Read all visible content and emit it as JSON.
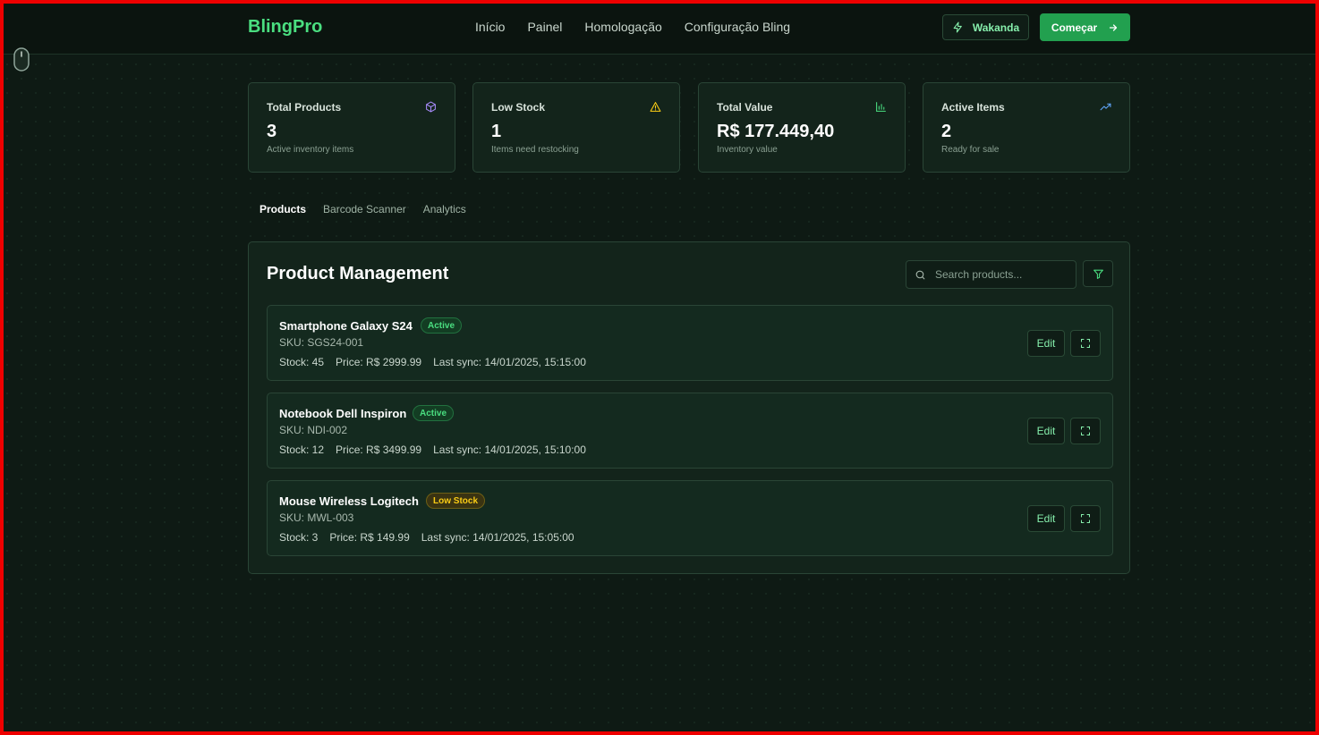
{
  "header": {
    "brand": "BlingPro",
    "nav": [
      "Início",
      "Painel",
      "Homologação",
      "Configuração Bling"
    ],
    "wakanda_label": "Wakanda",
    "start_label": "Começar"
  },
  "stats": [
    {
      "title": "Total Products",
      "value": "3",
      "subtitle": "Active inventory items",
      "icon": "package-icon",
      "icon_color": "#a78bfa"
    },
    {
      "title": "Low Stock",
      "value": "1",
      "subtitle": "Items need restocking",
      "icon": "warning-icon",
      "icon_color": "#facc15"
    },
    {
      "title": "Total Value",
      "value": "R$ 177.449,40",
      "subtitle": "Inventory value",
      "icon": "bar-chart-icon",
      "icon_color": "#4ade80"
    },
    {
      "title": "Active Items",
      "value": "2",
      "subtitle": "Ready for sale",
      "icon": "trending-up-icon",
      "icon_color": "#60a5fa"
    }
  ],
  "tabs": [
    {
      "label": "Products",
      "active": true
    },
    {
      "label": "Barcode Scanner",
      "active": false
    },
    {
      "label": "Analytics",
      "active": false
    }
  ],
  "panel": {
    "title": "Product Management",
    "search_placeholder": "Search products...",
    "edit_label": "Edit"
  },
  "products": [
    {
      "name": "Smartphone Galaxy S24",
      "status": "Active",
      "sku": "SKU: SGS24-001",
      "stock": "Stock: 45",
      "price": "Price: R$ 2999.99",
      "sync": "Last sync: 14/01/2025, 15:15:00"
    },
    {
      "name": "Notebook Dell Inspiron",
      "status": "Active",
      "sku": "SKU: NDI-002",
      "stock": "Stock: 12",
      "price": "Price: R$ 3499.99",
      "sync": "Last sync: 14/01/2025, 15:10:00"
    },
    {
      "name": "Mouse Wireless Logitech",
      "status": "Low Stock",
      "sku": "SKU: MWL-003",
      "stock": "Stock: 3",
      "price": "Price: R$ 149.99",
      "sync": "Last sync: 14/01/2025, 15:05:00"
    }
  ],
  "colors": {
    "accent": "#4ade80",
    "background": "#0e1a14",
    "primary_button": "#22a04f",
    "low_stock": "#facc15"
  }
}
